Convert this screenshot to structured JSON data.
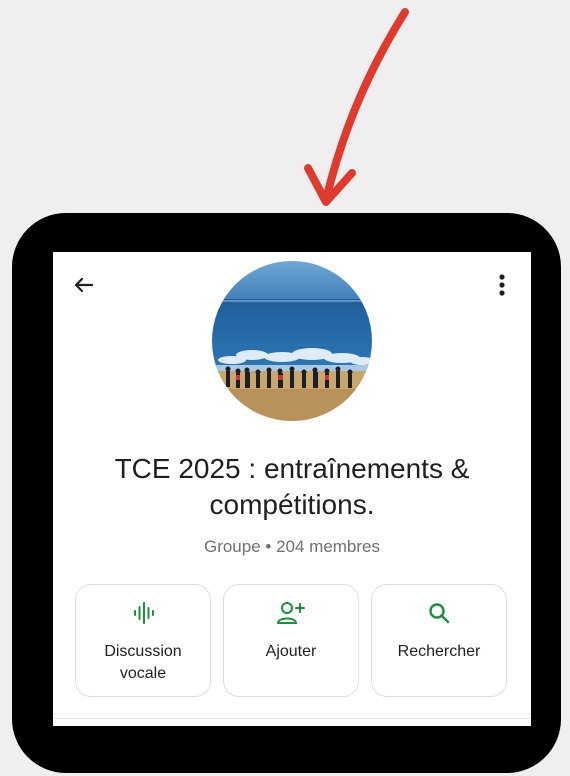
{
  "header": {
    "back_icon": "arrow-left-icon",
    "more_icon": "more-vertical-icon"
  },
  "group": {
    "name": "TCE 2025 : entraînements & compétitions.",
    "meta": "Groupe • 204 membres"
  },
  "actions": [
    {
      "label": "Discussion vocale",
      "icon": "audio-waveform-icon"
    },
    {
      "label": "Ajouter",
      "icon": "add-person-icon"
    },
    {
      "label": "Rechercher",
      "icon": "search-icon"
    }
  ],
  "colors": {
    "accent": "#1e8e3e",
    "annotation_arrow": "#e03a2f",
    "frame": "#000000",
    "background": "#efefef"
  }
}
